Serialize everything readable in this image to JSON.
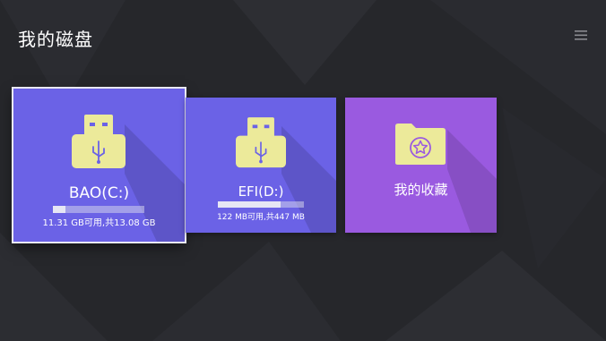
{
  "page": {
    "title": "我的磁盘",
    "menu_icon": "hamburger-menu-icon"
  },
  "colors": {
    "background": "#26272b",
    "drive_tile": "#6b62e6",
    "favorites_tile": "#9a5ae0",
    "icon_yellow": "#ecea9a",
    "focus_border": "#e9e9f2"
  },
  "tiles": [
    {
      "label": "BAO(C:)",
      "icon": "usb-drive-icon",
      "usage_text": "11.31 GB可用,共13.08 GB",
      "used_fraction": 0.135,
      "focused": true
    },
    {
      "label": "EFI(D:)",
      "icon": "usb-drive-icon",
      "usage_text": "122 MB可用,共447 MB",
      "used_fraction": 0.727,
      "focused": false
    },
    {
      "label": "我的收藏",
      "icon": "star-folder-icon",
      "focused": false
    }
  ]
}
